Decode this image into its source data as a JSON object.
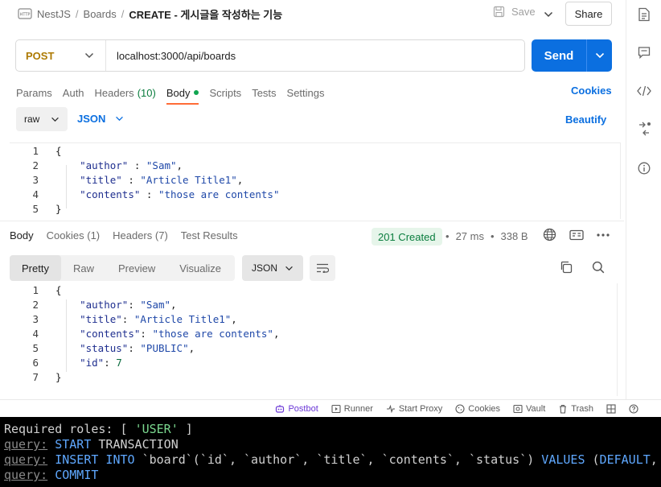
{
  "header": {
    "breadcrumb": [
      "NestJS",
      "Boards"
    ],
    "separator": "/",
    "current": "CREATE - 게시글을 작성하는 기능",
    "save_label": "Save",
    "share_label": "Share"
  },
  "request": {
    "method": "POST",
    "url": "localhost:3000/api/boards",
    "send_label": "Send"
  },
  "request_tabs": {
    "params": "Params",
    "auth": "Auth",
    "headers": "Headers",
    "headers_count": "(10)",
    "body": "Body",
    "scripts": "Scripts",
    "tests": "Tests",
    "settings": "Settings",
    "cookies": "Cookies"
  },
  "body_options": {
    "mode": "raw",
    "format": "JSON",
    "beautify": "Beautify"
  },
  "request_body": [
    {
      "n": "1",
      "parts": [
        {
          "t": "{",
          "c": "punc"
        }
      ]
    },
    {
      "n": "2",
      "parts": [
        {
          "t": "    ",
          "c": "punc"
        },
        {
          "t": "\"author\"",
          "c": "key"
        },
        {
          "t": " : ",
          "c": "punc"
        },
        {
          "t": "\"Sam\"",
          "c": "str"
        },
        {
          "t": ",",
          "c": "punc"
        }
      ]
    },
    {
      "n": "3",
      "parts": [
        {
          "t": "    ",
          "c": "punc"
        },
        {
          "t": "\"title\"",
          "c": "key"
        },
        {
          "t": " : ",
          "c": "punc"
        },
        {
          "t": "\"Article Title1\"",
          "c": "str"
        },
        {
          "t": ",",
          "c": "punc"
        }
      ]
    },
    {
      "n": "4",
      "parts": [
        {
          "t": "    ",
          "c": "punc"
        },
        {
          "t": "\"contents\"",
          "c": "key"
        },
        {
          "t": " : ",
          "c": "punc"
        },
        {
          "t": "\"those are contents\"",
          "c": "str"
        }
      ]
    },
    {
      "n": "5",
      "parts": [
        {
          "t": "}",
          "c": "punc"
        }
      ]
    }
  ],
  "response_tabs": {
    "body": "Body",
    "cookies": "Cookies",
    "cookies_count": "(1)",
    "headers": "Headers",
    "headers_count": "(7)",
    "test_results": "Test Results"
  },
  "response_meta": {
    "status": "201 Created",
    "time": "27 ms",
    "size": "338 B",
    "bullet": "•"
  },
  "view_tabs": [
    "Pretty",
    "Raw",
    "Preview",
    "Visualize"
  ],
  "response_format": "JSON",
  "response_body": [
    {
      "n": "1",
      "parts": [
        {
          "t": "{",
          "c": "punc"
        }
      ]
    },
    {
      "n": "2",
      "parts": [
        {
          "t": "    ",
          "c": "punc"
        },
        {
          "t": "\"author\"",
          "c": "key"
        },
        {
          "t": ": ",
          "c": "punc"
        },
        {
          "t": "\"Sam\"",
          "c": "str"
        },
        {
          "t": ",",
          "c": "punc"
        }
      ]
    },
    {
      "n": "3",
      "parts": [
        {
          "t": "    ",
          "c": "punc"
        },
        {
          "t": "\"title\"",
          "c": "key"
        },
        {
          "t": ": ",
          "c": "punc"
        },
        {
          "t": "\"Article Title1\"",
          "c": "str"
        },
        {
          "t": ",",
          "c": "punc"
        }
      ]
    },
    {
      "n": "4",
      "parts": [
        {
          "t": "    ",
          "c": "punc"
        },
        {
          "t": "\"contents\"",
          "c": "key"
        },
        {
          "t": ": ",
          "c": "punc"
        },
        {
          "t": "\"those are contents\"",
          "c": "str"
        },
        {
          "t": ",",
          "c": "punc"
        }
      ]
    },
    {
      "n": "5",
      "parts": [
        {
          "t": "    ",
          "c": "punc"
        },
        {
          "t": "\"status\"",
          "c": "key"
        },
        {
          "t": ": ",
          "c": "punc"
        },
        {
          "t": "\"PUBLIC\"",
          "c": "str"
        },
        {
          "t": ",",
          "c": "punc"
        }
      ]
    },
    {
      "n": "6",
      "parts": [
        {
          "t": "    ",
          "c": "punc"
        },
        {
          "t": "\"id\"",
          "c": "key"
        },
        {
          "t": ": ",
          "c": "punc"
        },
        {
          "t": "7",
          "c": "num"
        }
      ]
    },
    {
      "n": "7",
      "parts": [
        {
          "t": "}",
          "c": "punc"
        }
      ]
    }
  ],
  "statusbar": [
    "Postbot",
    "Runner",
    "Start Proxy",
    "Cookies",
    "Vault",
    "Trash"
  ],
  "terminal": [
    [
      {
        "t": "Required roles: [ ",
        "c": "plain"
      },
      {
        "t": "'USER'",
        "c": "str"
      },
      {
        "t": " ]",
        "c": "plain"
      }
    ],
    [
      {
        "t": "query:",
        "c": "query"
      },
      {
        "t": " START ",
        "c": "kw"
      },
      {
        "t": "TRANSACTION",
        "c": "plain"
      }
    ],
    [
      {
        "t": "query:",
        "c": "query"
      },
      {
        "t": " INSERT INTO ",
        "c": "kw"
      },
      {
        "t": "`board`(`id`, `author`, `title`, `contents`, `status`) ",
        "c": "plain"
      },
      {
        "t": "VALUES",
        "c": "kw"
      },
      {
        "t": " (",
        "c": "plain"
      },
      {
        "t": "DEFAULT",
        "c": "kw"
      },
      {
        "t": ", ?, ?, ?, ?)",
        "c": "plain"
      }
    ],
    [
      {
        "t": "query:",
        "c": "query"
      },
      {
        "t": " COMMIT",
        "c": "kw"
      }
    ]
  ],
  "colors": {
    "accent": "#0b6fe0",
    "method": "#ad7a03",
    "status_ok": "#0a7d3e",
    "tab_indicator": "#ff6c37"
  }
}
